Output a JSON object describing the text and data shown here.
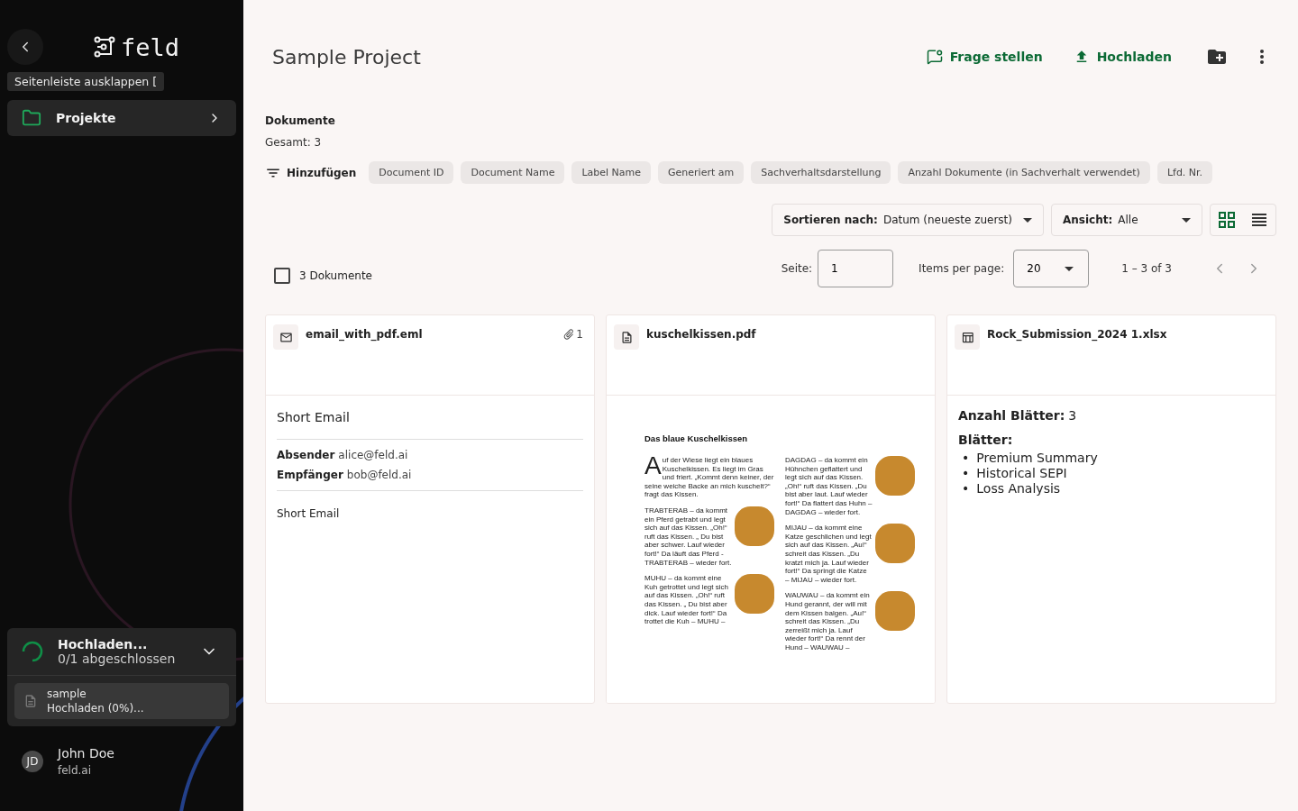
{
  "sidebar": {
    "logo": "feld",
    "tooltip": "Seitenleiste ausklappen [",
    "nav": [
      {
        "label": "Projekte",
        "selected": true
      }
    ],
    "upload": {
      "title": "Hochladen...",
      "status": "0/1 abgeschlossen",
      "expanded": true,
      "files": [
        {
          "name": "sample",
          "status": "Hochladen (0%)..."
        }
      ]
    },
    "user": {
      "initials": "JD",
      "name": "John Doe",
      "org": "feld.ai"
    }
  },
  "header": {
    "title": "Sample Project",
    "actions": [
      {
        "kind": "ask",
        "label": "Frage stellen"
      },
      {
        "kind": "upload",
        "label": "Hochladen"
      },
      {
        "kind": "new-folder"
      },
      {
        "kind": "more"
      }
    ]
  },
  "documents": {
    "heading": "Dokumente",
    "total": "Gesamt: 3",
    "filter_label": "Hinzufügen",
    "columns": [
      "Document ID",
      "Document Name",
      "Label Name",
      "Generiert am",
      "Sachverhaltsdarstellung",
      "Anzahl Dokumente (in Sachverhalt verwendet)",
      "Lfd. Nr."
    ],
    "sort": {
      "label": "Sortieren nach:",
      "value": "Datum (neueste zuerst)"
    },
    "view": {
      "label": "Ansicht:",
      "value": "Alle",
      "modes": [
        {
          "kind": "grid",
          "selected": true
        },
        {
          "kind": "list",
          "selected": false
        }
      ]
    },
    "select_all": {
      "checked": false,
      "label": "3 Dokumente"
    },
    "pagination": {
      "page_label": "Seite:",
      "page": "1",
      "per_page_label": "Items per page:",
      "per_page": "20",
      "range": "1 – 3 of 3"
    },
    "cards": [
      {
        "kind": "email",
        "name": "email_with_pdf.eml",
        "attachments": "1",
        "subject": "Short Email",
        "fields": [
          {
            "label": "Absender",
            "value": "alice@feld.ai"
          },
          {
            "label": "Empfänger",
            "value": "bob@feld.ai"
          }
        ],
        "body": "Short Email"
      },
      {
        "kind": "pdf",
        "name": "kuschelkissen.pdf",
        "preview": {
          "title": "Das blaue Kuschelkissen",
          "columns": [
            [
              {
                "text": "Auf der Wiese liegt ein blaues Kuschelkissen. Es liegt im Gras und friert. „Kommt denn keiner, der seine weiche Backe an mich kuschelt?“ fragt das Kissen.",
                "illustration": false,
                "drop_cap": true
              },
              {
                "text": "TRABTERAB – da kommt ein Pferd getrabt und legt sich auf das Kissen. „Oh!“ ruft das Kissen. „ Du bist aber schwer. Lauf wieder fort!“ Da läuft das Pferd - TRABTERAB – wieder fort.",
                "illustration": true,
                "drop_cap": false
              },
              {
                "text": "MUHU – da kommt eine Kuh getrottet und legt sich auf das Kissen. „Oh!“ ruft das Kissen. „ Du bist aber dick. Lauf wieder fort!“ Da trottet die Kuh – MUHU –",
                "illustration": true,
                "drop_cap": false
              }
            ],
            [
              {
                "text": "DAGDAG – da kommt ein Hühnchen geflattert und legt sich auf das Kissen. „Oh!“ ruft das Kissen. „Du bist aber laut. Lauf wieder fort!“ Da flattert das Huhn – DAGDAG – wieder fort.",
                "illustration": true,
                "drop_cap": false
              },
              {
                "text": "MIJAU – da kommt eine Katze geschlichen und legt sich auf das Kissen. „Au!“ schreit das Kissen. „Du kratzt mich ja. Lauf wieder fort!“ Da springt die Katze – MIJAU – wieder fort.",
                "illustration": true,
                "drop_cap": false
              },
              {
                "text": "WAUWAU – da kommt ein Hund gerannt, der will mit dem Kissen balgen. „Au!“ schreit das Kissen. „Du zerreißt mich ja. Lauf wieder fort!“ Da rennt der Hund – WAUWAU –",
                "illustration": true,
                "drop_cap": false
              }
            ]
          ]
        }
      },
      {
        "kind": "sheet",
        "name": "Rock_Submission_2024 1.xlsx",
        "count_label": "Anzahl Blätter:",
        "count": "3",
        "sheets_label": "Blätter:",
        "sheets": [
          {
            "bullet": "•",
            "name": "Premium Summary"
          },
          {
            "bullet": "•",
            "name": "Historical SEPI"
          },
          {
            "bullet": "•",
            "name": "Loss Analysis"
          }
        ]
      }
    ]
  }
}
